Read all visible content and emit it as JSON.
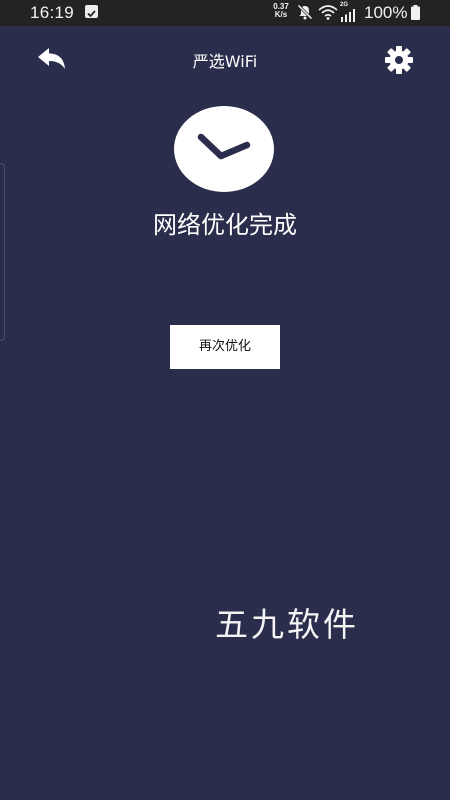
{
  "status_bar": {
    "time": "16:19",
    "net_speed_value": "0.37",
    "net_speed_unit": "K/s",
    "network_type": "2G",
    "battery_percent": "100%",
    "icons": [
      "notification-check-icon",
      "mute-icon",
      "wifi-icon",
      "signal-icon",
      "battery-icon"
    ]
  },
  "app_bar": {
    "title": "严选WiFi",
    "back_icon": "reply-arrow-icon",
    "settings_icon": "gear-icon"
  },
  "result": {
    "badge_icon": "checkmark-icon",
    "title": "网络优化完成",
    "action_label": "再次优化"
  },
  "watermark": {
    "text": "五九软件"
  },
  "colors": {
    "background": "#2a2d4b",
    "status_bar": "#232323",
    "foreground": "#ffffff"
  }
}
